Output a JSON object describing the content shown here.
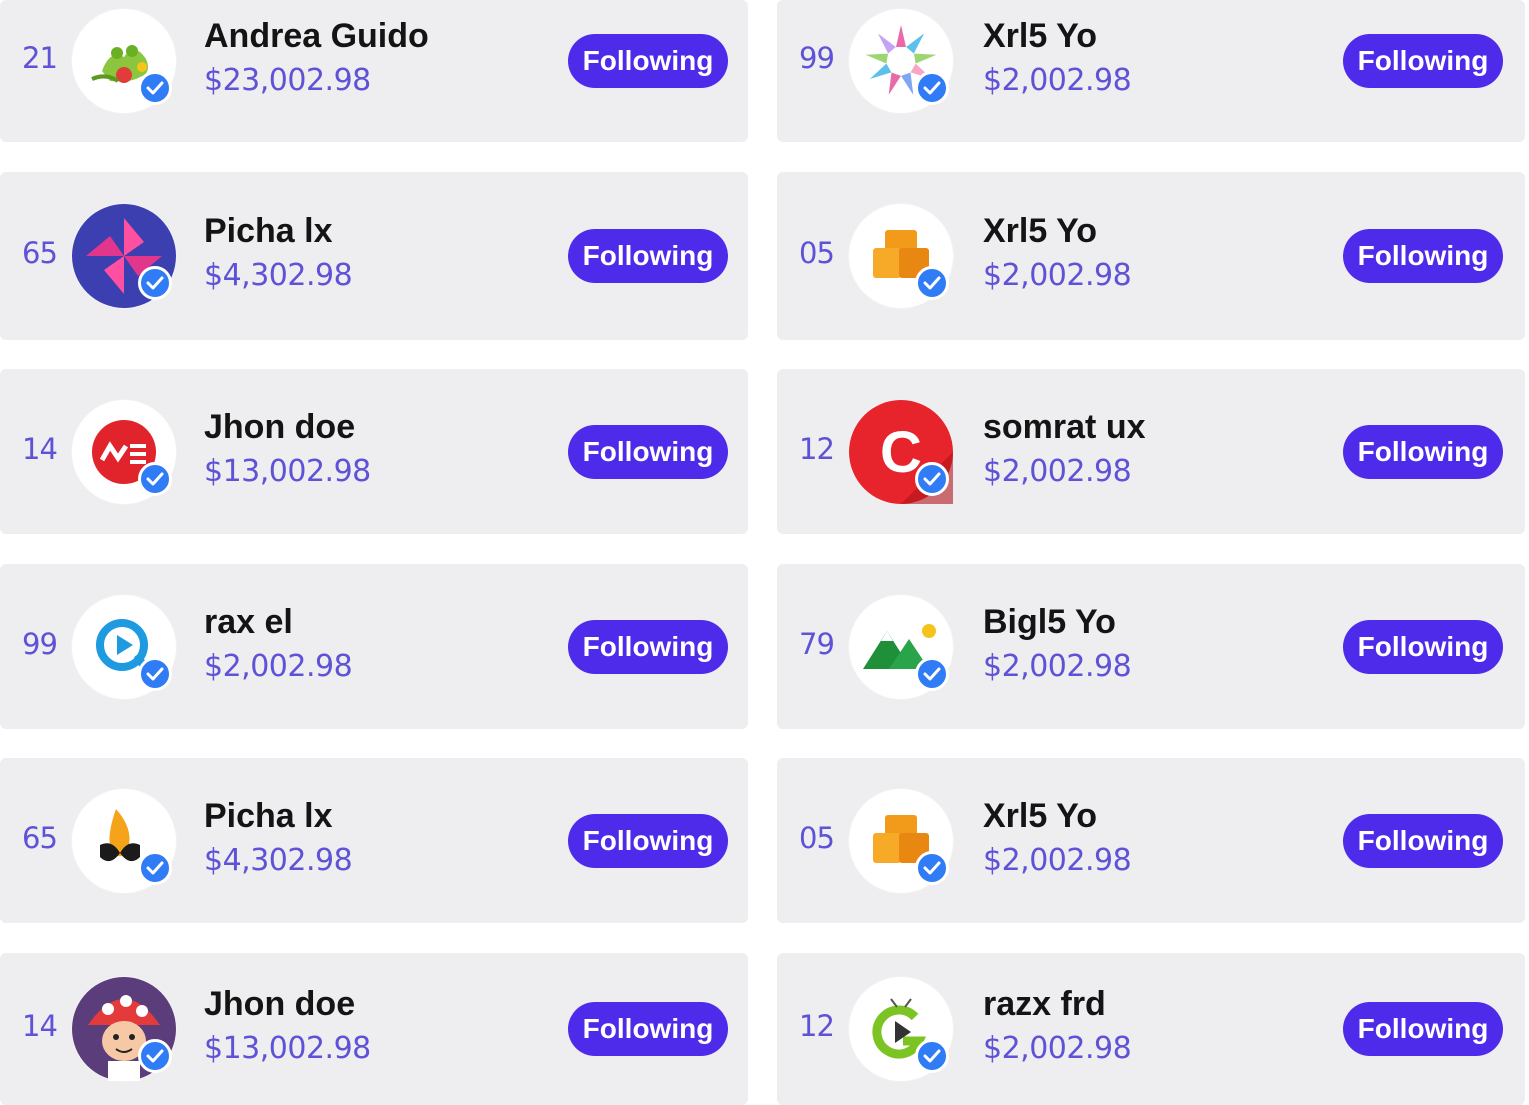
{
  "rows": [
    {
      "left": {
        "rank": "21",
        "name": "Andrea Guido",
        "amount": "$23,002.98",
        "button": "Following",
        "avatar": "frog-plant-icon"
      },
      "right": {
        "rank": "99",
        "name": "Xrl5 Yo",
        "amount": "$2,002.98",
        "button": "Following",
        "avatar": "starburst-icon"
      }
    },
    {
      "left": {
        "rank": "65",
        "name": "Picha lx",
        "amount": "$4,302.98",
        "button": "Following",
        "avatar": "pinwheel-icon"
      },
      "right": {
        "rank": "05",
        "name": "Xrl5 Yo",
        "amount": "$2,002.98",
        "button": "Following",
        "avatar": "boxes-icon"
      }
    },
    {
      "left": {
        "rank": "14",
        "name": "Jhon doe",
        "amount": "$13,002.98",
        "button": "Following",
        "avatar": "me-logo-icon"
      },
      "right": {
        "rank": "12",
        "name": "somrat ux",
        "amount": "$2,002.98",
        "button": "Following",
        "avatar": "c-logo-icon"
      }
    },
    {
      "left": {
        "rank": "99",
        "name": "rax el",
        "amount": "$2,002.98",
        "button": "Following",
        "avatar": "play-bubble-icon"
      },
      "right": {
        "rank": "79",
        "name": "Bigl5 Yo",
        "amount": "$2,002.98",
        "button": "Following",
        "avatar": "mountains-icon"
      }
    },
    {
      "left": {
        "rank": "65",
        "name": "Picha lx",
        "amount": "$4,302.98",
        "button": "Following",
        "avatar": "flame-butterfly-icon"
      },
      "right": {
        "rank": "05",
        "name": "Xrl5 Yo",
        "amount": "$2,002.98",
        "button": "Following",
        "avatar": "boxes-icon"
      }
    },
    {
      "left": {
        "rank": "14",
        "name": "Jhon doe",
        "amount": "$13,002.98",
        "button": "Following",
        "avatar": "mushroom-avatar-icon"
      },
      "right": {
        "rank": "12",
        "name": "razx frd",
        "amount": "$2,002.98",
        "button": "Following",
        "avatar": "g-play-icon"
      }
    }
  ],
  "colors": {
    "accent": "#4e2bea",
    "rank_text": "#5e52d6",
    "card_bg": "#eeedef",
    "verified": "#2f7cf6"
  },
  "icons": {
    "verified": "verified-check-icon"
  }
}
